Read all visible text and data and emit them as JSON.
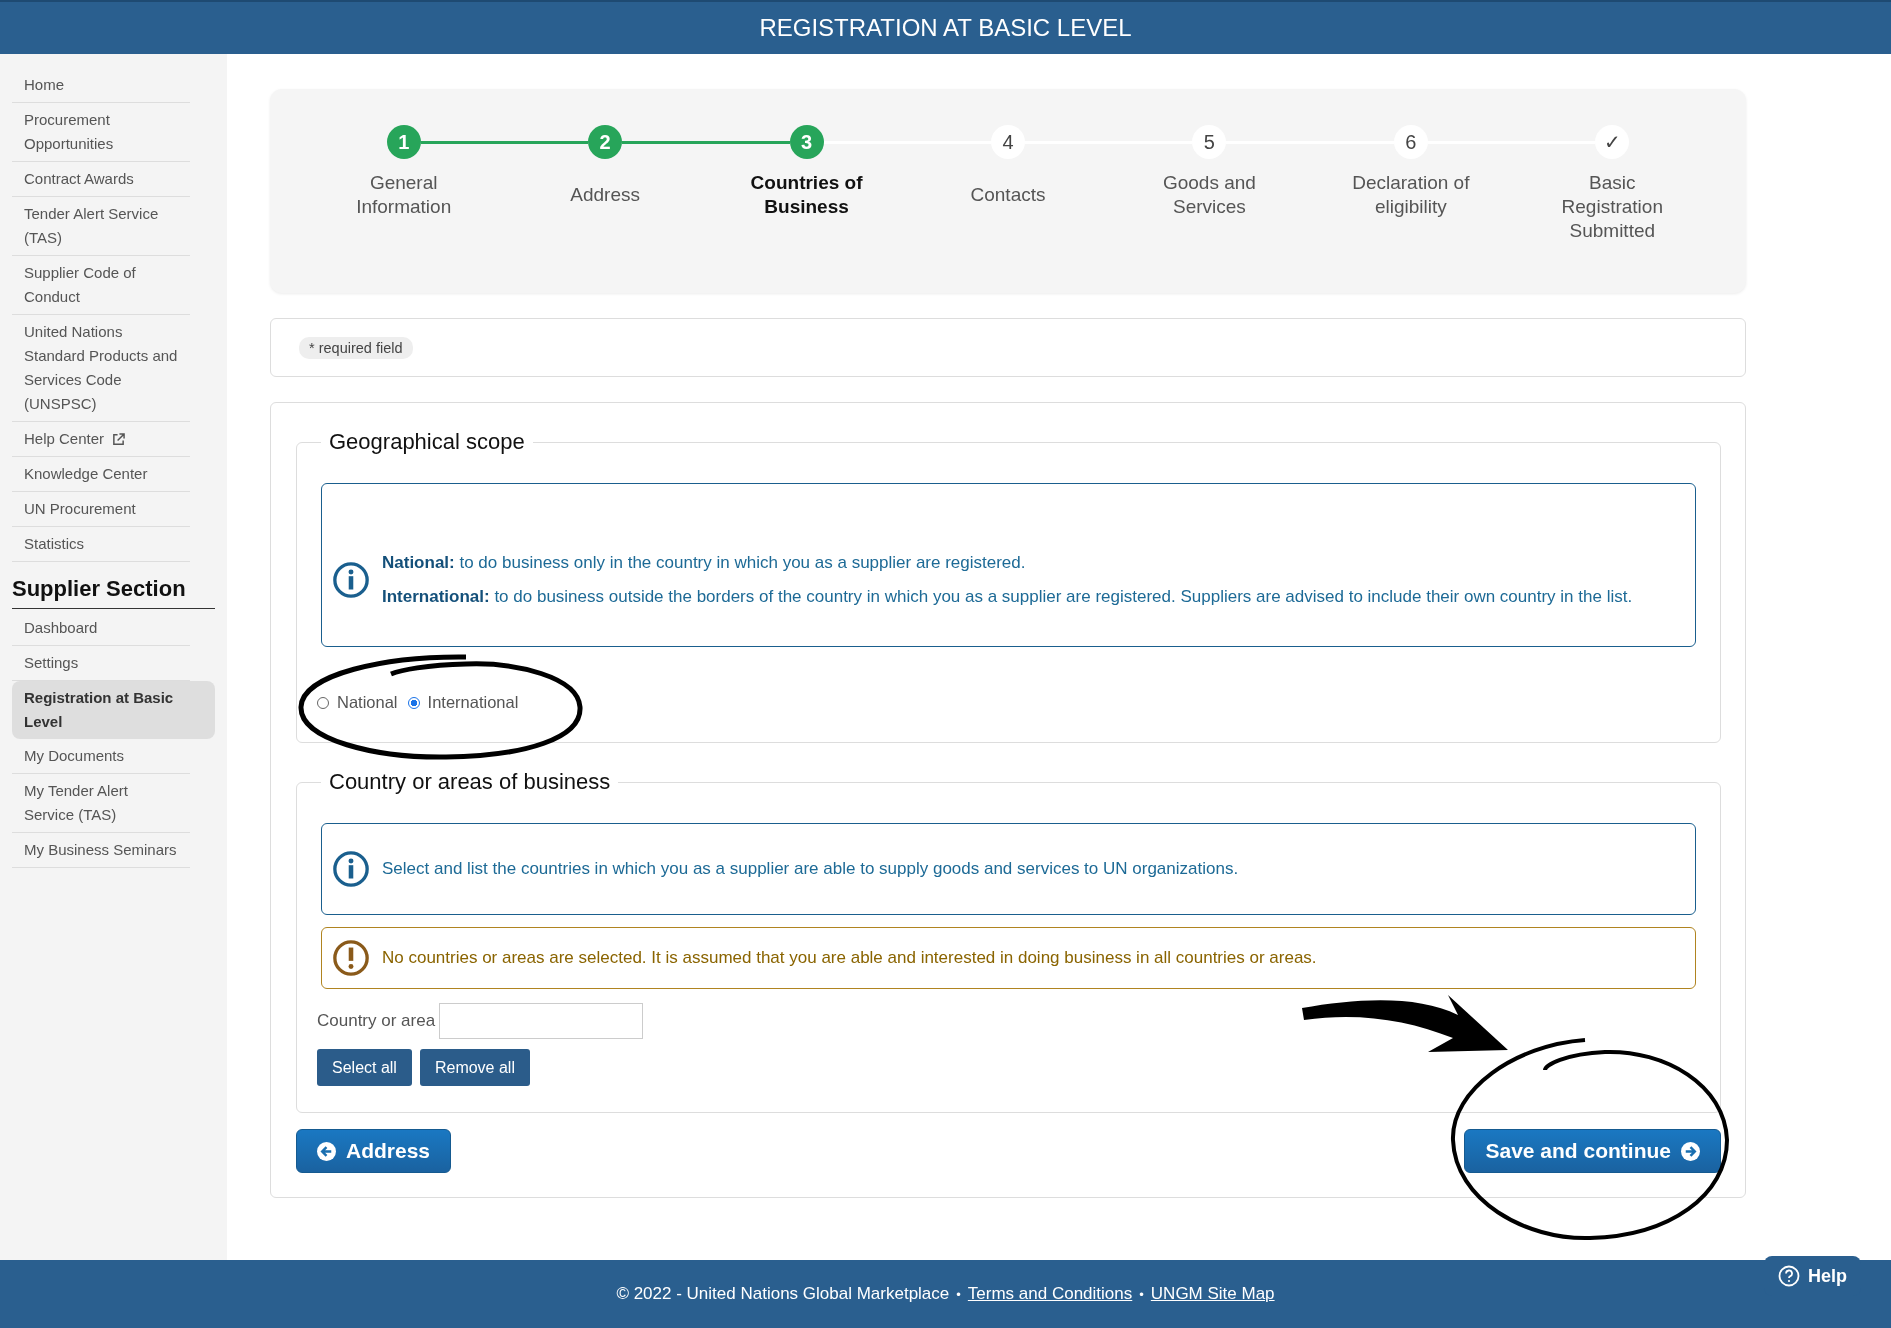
{
  "header": {
    "title": "REGISTRATION AT BASIC LEVEL"
  },
  "sidebar": {
    "items": [
      {
        "label": "Home",
        "kind": "link"
      },
      {
        "label": "Procurement Opportunities",
        "kind": "link"
      },
      {
        "label": "Contract Awards",
        "kind": "link"
      },
      {
        "label": "Tender Alert Service (TAS)",
        "kind": "link"
      },
      {
        "label": "Supplier Code of Conduct",
        "kind": "link"
      },
      {
        "label": "United Nations Standard Products and Services Code (UNSPSC)",
        "kind": "link"
      },
      {
        "label": "Help Center",
        "kind": "external"
      },
      {
        "label": "Knowledge Center",
        "kind": "link"
      },
      {
        "label": "UN Procurement",
        "kind": "link"
      },
      {
        "label": "Statistics",
        "kind": "link"
      }
    ],
    "section_title": "Supplier Section",
    "section_items": [
      {
        "label": "Dashboard",
        "selected": false
      },
      {
        "label": "Settings",
        "selected": false
      },
      {
        "label": "Registration at Basic Level",
        "selected": true
      },
      {
        "label": "My Documents",
        "selected": false
      },
      {
        "label": "My Tender Alert Service (TAS)",
        "selected": false
      },
      {
        "label": "My Business Seminars",
        "selected": false
      }
    ]
  },
  "stepper": {
    "steps": [
      {
        "number": "1",
        "label": "General Information",
        "reached": true,
        "current": false
      },
      {
        "number": "2",
        "label": "Address",
        "reached": true,
        "current": false
      },
      {
        "number": "3",
        "label": "Countries of Business",
        "reached": true,
        "current": true
      },
      {
        "number": "4",
        "label": "Contacts",
        "reached": false,
        "current": false
      },
      {
        "number": "5",
        "label": "Goods and Services",
        "reached": false,
        "current": false
      },
      {
        "number": "6",
        "label": "Declaration of eligibility",
        "reached": false,
        "current": false
      },
      {
        "number": "✓",
        "label": "Basic Registration Submitted",
        "reached": false,
        "current": false
      }
    ]
  },
  "required_note": "* required field",
  "geographical_scope": {
    "title": "Geographical scope",
    "info": [
      "**National:** to do business only in the country in which you as a supplier are registered.",
      "**International:** to do business outside the borders of the country in which you as a supplier are registered. Suppliers are advised to include their own country in the list."
    ],
    "options": [
      {
        "label": "National",
        "selected": false
      },
      {
        "label": "International",
        "selected": true
      }
    ]
  },
  "countries": {
    "title": "Country or areas of business",
    "info": "Select and list the countries in which you as a supplier are able to supply goods and services to UN organizations.",
    "warning": "No countries or areas are selected. It is assumed that you are able and interested in doing business in all countries or areas.",
    "field_label": "Country or area",
    "buttons": [
      "Select all",
      "Remove all"
    ]
  },
  "navigation": {
    "back": "Address",
    "next": "Save and continue"
  },
  "footer": {
    "copyright": "© 2022 - United Nations Global Marketplace",
    "separator": "•",
    "links": [
      "Terms and Conditions",
      "UNGM Site Map"
    ],
    "help": "Help"
  }
}
